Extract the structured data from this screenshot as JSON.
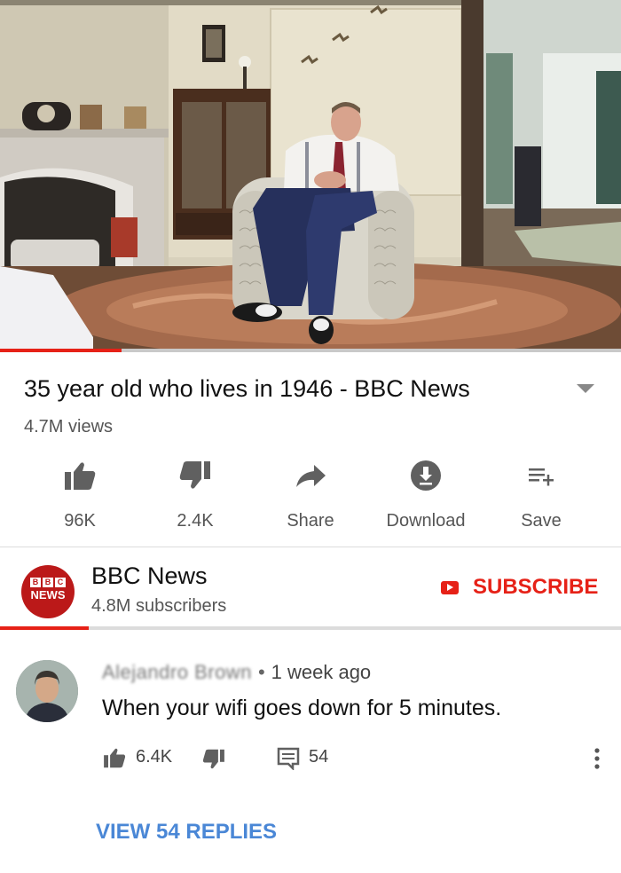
{
  "video": {
    "progress_fraction": 0.195
  },
  "title": "35 year old who lives in 1946 - BBC News",
  "views": "4.7M views",
  "actions": [
    {
      "label": "96K",
      "icon": "thumb-up-icon"
    },
    {
      "label": "2.4K",
      "icon": "thumb-down-icon"
    },
    {
      "label": "Share",
      "icon": "share-arrow-icon"
    },
    {
      "label": "Download",
      "icon": "download-icon"
    },
    {
      "label": "Save",
      "icon": "playlist-add-icon"
    }
  ],
  "channel": {
    "logo_top": [
      "B",
      "B",
      "C"
    ],
    "logo_bottom": "NEWS",
    "name": "BBC News",
    "subscribers": "4.8M subscribers",
    "subscribe_label": "SUBSCRIBE"
  },
  "comment": {
    "author": "Alejandro Brown",
    "time": "1 week ago",
    "text": "When your wifi goes down for 5 minutes.",
    "likes": "6.4K",
    "reply_count": "54",
    "view_replies": "VIEW 54 REPLIES"
  },
  "colors": {
    "brand_red": "#e62117",
    "bbc_red": "#bb1919",
    "link_blue": "#4a87d6"
  }
}
